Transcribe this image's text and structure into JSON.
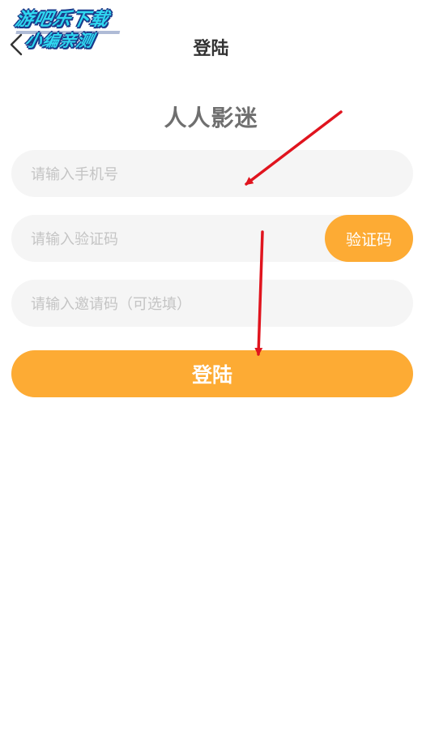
{
  "watermark": {
    "line1": "游吧乐下载",
    "line2": "小编亲测"
  },
  "header": {
    "back_icon": "chevron-left-icon",
    "title": "登陆"
  },
  "app_name": "人人影迷",
  "form": {
    "phone": {
      "value": "",
      "placeholder": "请输入手机号"
    },
    "code": {
      "value": "",
      "placeholder": "请输入验证码",
      "button_label": "验证码"
    },
    "invite": {
      "value": "",
      "placeholder": "请输入邀请码（可选填）"
    },
    "submit_label": "登陆"
  },
  "colors": {
    "accent": "#fdab34",
    "field_bg": "#f5f5f5",
    "placeholder": "#c4c4c4",
    "title": "#333333",
    "app_name": "#6f6f6f",
    "annotation_arrow": "#e0141e"
  }
}
